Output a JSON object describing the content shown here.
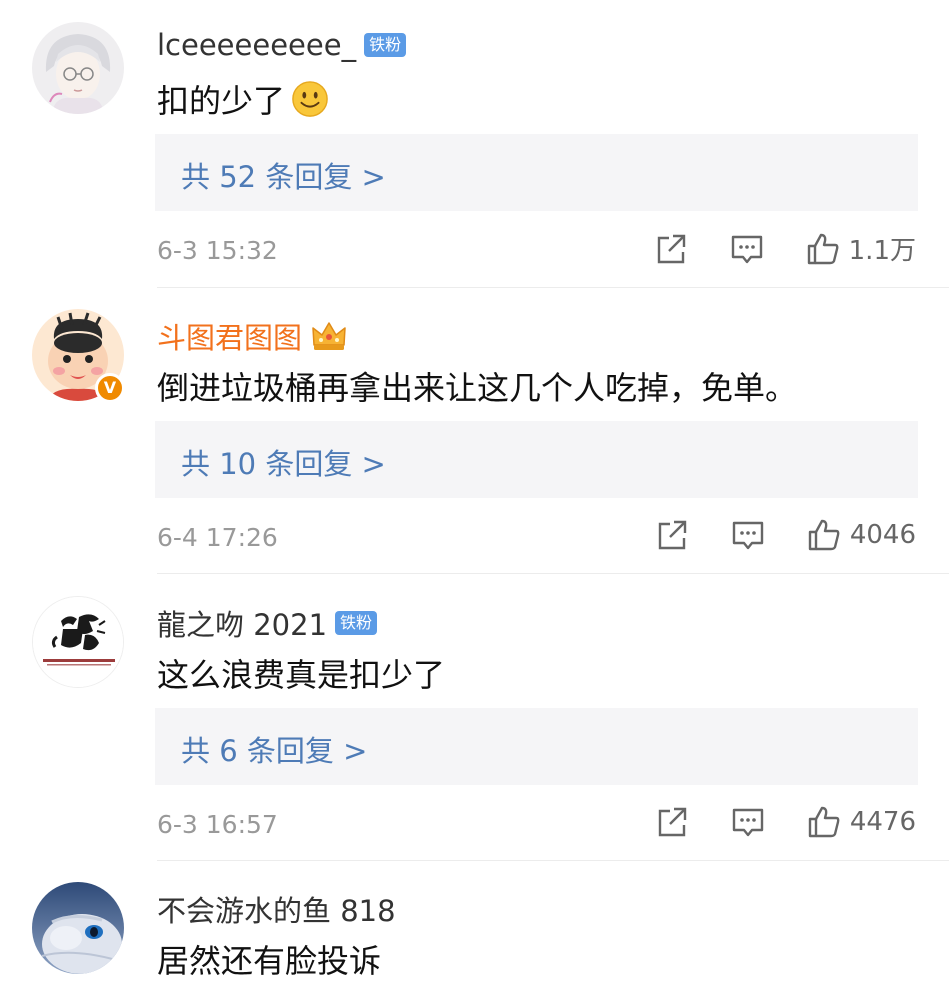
{
  "comments": [
    {
      "username": "lceeeeeeeee_",
      "badge": "铁粉",
      "text": "扣的少了",
      "emoji": "smile-emoji",
      "replies": "共 52 条回复 >",
      "date": "6-3 15:32",
      "likes": "1.1万"
    },
    {
      "username": "斗图君图图",
      "badge_icon": "crown-icon",
      "verified": "V",
      "text": "倒进垃圾桶再拿出来让这几个人吃掉，免单。",
      "replies": "共 10 条回复 >",
      "date": "6-4 17:26",
      "likes": "4046"
    },
    {
      "username": "龍之吻 2021",
      "badge": "铁粉",
      "text": "这么浪费真是扣少了",
      "replies": "共 6 条回复 >",
      "date": "6-3 16:57",
      "likes": "4476"
    },
    {
      "username": "不会游水的鱼 818",
      "text": "居然还有脸投诉"
    }
  ],
  "colors": {
    "reply_link": "#4e7bb6",
    "vip_name": "#f2711c",
    "fan_badge": "#5b9be6",
    "verified_badge": "#f08a00"
  }
}
